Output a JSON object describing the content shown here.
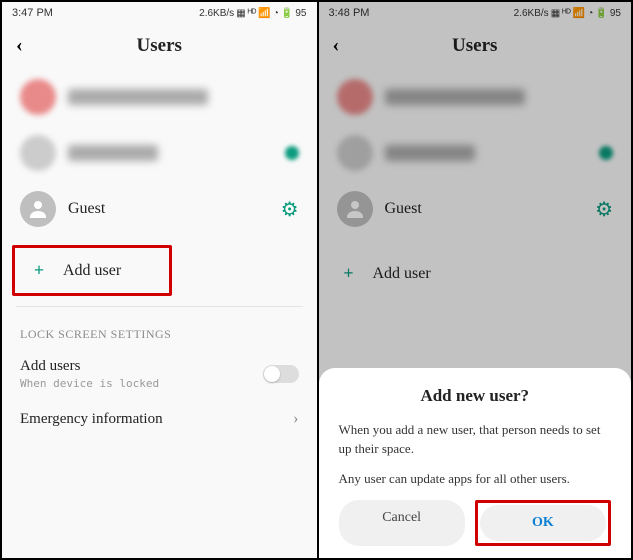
{
  "left": {
    "status": {
      "time": "3:47 PM",
      "net": "2.6KB/s",
      "battery": "95"
    },
    "header": {
      "title": "Users"
    },
    "guest_label": "Guest",
    "add_user_label": "Add user",
    "section_label": "LOCK SCREEN SETTINGS",
    "add_users_title": "Add users",
    "add_users_sub": "When device is locked",
    "emergency_label": "Emergency information"
  },
  "right": {
    "status": {
      "time": "3:48 PM",
      "net": "2.6KB/s",
      "battery": "95"
    },
    "header": {
      "title": "Users"
    },
    "guest_label": "Guest",
    "add_user_label": "Add user",
    "dialog": {
      "title": "Add new user?",
      "body1": "When you add a new user, that person needs to set up their space.",
      "body2": "Any user can update apps for all other users.",
      "cancel": "Cancel",
      "ok": "OK"
    }
  }
}
